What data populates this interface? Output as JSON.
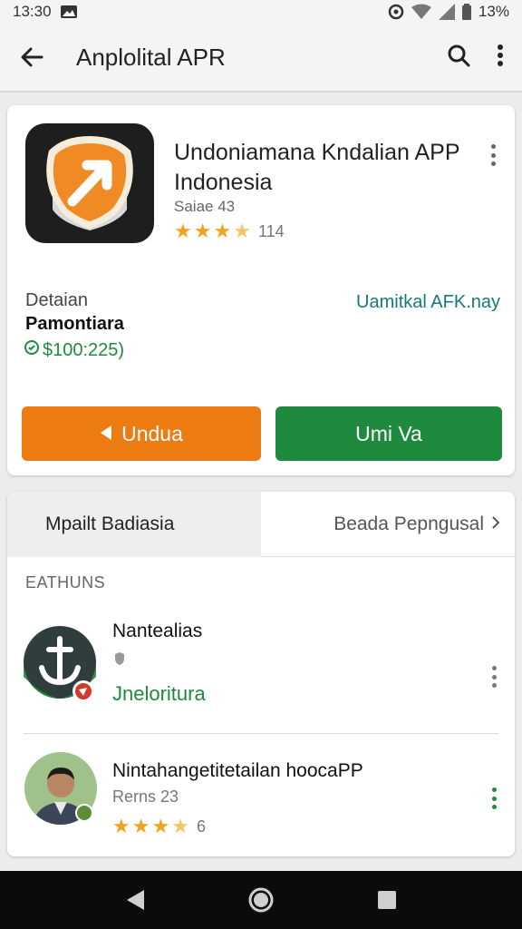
{
  "status_bar": {
    "time": "13:30",
    "battery_text": "13%",
    "icons": [
      "image-icon",
      "alarm-icon",
      "wifi-icon",
      "signal-icon",
      "battery-icon"
    ]
  },
  "toolbar": {
    "title": "Anplolital APR",
    "icons": [
      "back-arrow-icon",
      "search-icon",
      "more-vert-icon"
    ]
  },
  "app": {
    "title": "Undoniamana Kndalian APP Indonesia",
    "subtitle": "Saiae 43",
    "rating": 3.5,
    "rating_count": "114",
    "details_label": "Detaian",
    "details_value": "Pamontiara",
    "price": "$100:225)",
    "link_text": "Uamitkal AFK.nay",
    "download_label": "Undua",
    "open_label": "Umi Va",
    "colors": {
      "download": "#ec7b12",
      "open": "#1f8a3e",
      "icon_bg": "#1e1e1e",
      "icon_badge": "#f08a24"
    }
  },
  "tabs": {
    "active": "Mpailt Badiasia",
    "other": "Beada Pepngusal"
  },
  "section_label": "EATHUNS",
  "list": [
    {
      "title": "Nantealias",
      "green_text": "Jneloritura"
    },
    {
      "title": "Nintahangetitetailan hoocaPP",
      "subtitle": "Rerns 23",
      "rating": 3.5,
      "rating_count": "6"
    }
  ]
}
